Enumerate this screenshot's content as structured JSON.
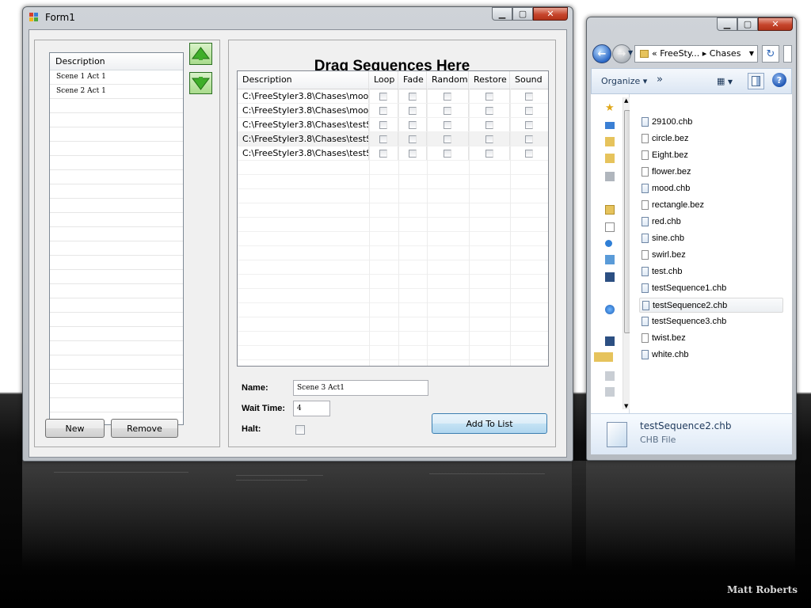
{
  "form_window": {
    "title": "Form1",
    "caption_buttons": [
      "minimize-icon",
      "maximize-icon",
      "close-icon"
    ],
    "scene_list": {
      "header": "Description",
      "items": [
        "Scene 1 Act 1",
        "Scene 2 Act 1"
      ]
    },
    "move_up_icon": "arrow-up-icon",
    "move_down_icon": "arrow-down-icon",
    "new_label": "New",
    "remove_label": "Remove",
    "heading": "Drag Sequences Here",
    "grid": {
      "columns": [
        "Description",
        "Loop",
        "Fade",
        "Random",
        "Restore",
        "Sound"
      ],
      "rows": [
        "C:\\FreeStyler3.8\\Chases\\mood...",
        "C:\\FreeStyler3.8\\Chases\\mood...",
        "C:\\FreeStyler3.8\\Chases\\testS...",
        "C:\\FreeStyler3.8\\Chases\\testS...",
        "C:\\FreeStyler3.8\\Chases\\testS..."
      ]
    },
    "name_label": "Name:",
    "name_value": "Scene 3 Act1",
    "wait_label": "Wait Time:",
    "wait_value": "4",
    "halt_label": "Halt:",
    "halt_checked": false,
    "add_label": "Add To List"
  },
  "explorer_window": {
    "address": "« FreeSty... ▸ Chases",
    "organize_label": "Organize ▾",
    "more_label": "»",
    "files": [
      {
        "name": "29100.chb",
        "type": "chb"
      },
      {
        "name": "circle.bez",
        "type": "bez"
      },
      {
        "name": "Eight.bez",
        "type": "bez"
      },
      {
        "name": "flower.bez",
        "type": "bez"
      },
      {
        "name": "mood.chb",
        "type": "chb"
      },
      {
        "name": "rectangle.bez",
        "type": "bez"
      },
      {
        "name": "red.chb",
        "type": "chb"
      },
      {
        "name": "sine.chb",
        "type": "chb"
      },
      {
        "name": "swirl.bez",
        "type": "bez"
      },
      {
        "name": "test.chb",
        "type": "chb"
      },
      {
        "name": "testSequence1.chb",
        "type": "chb"
      },
      {
        "name": "testSequence2.chb",
        "type": "chb",
        "selected": true
      },
      {
        "name": "testSequence3.chb",
        "type": "chb"
      },
      {
        "name": "twist.bez",
        "type": "bez"
      },
      {
        "name": "white.chb",
        "type": "chb"
      }
    ],
    "details_name": "testSequence2.chb",
    "details_type": "CHB File"
  },
  "watermark": "Matt Roberts",
  "colors": {
    "accent_green": "#3fae2a",
    "selection_blue": "#3c7fb1",
    "close_red": "#c6452c"
  }
}
